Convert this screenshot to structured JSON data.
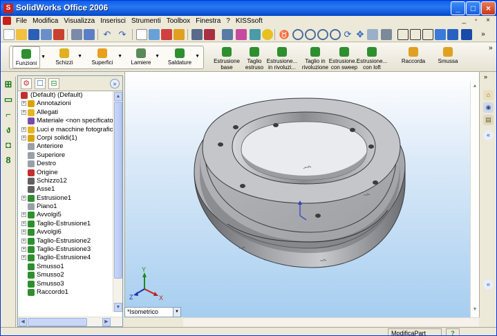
{
  "window": {
    "title": "SolidWorks Office 2006"
  },
  "menu": [
    "File",
    "Modifica",
    "Visualizza",
    "Inserisci",
    "Strumenti",
    "Toolbox",
    "Finestra",
    "?",
    "KISSsoft"
  ],
  "command_manager": {
    "left_group": [
      {
        "label": "Funzioni",
        "icon": "features-icon"
      },
      {
        "label": "Schizzi",
        "icon": "sketch-icon"
      },
      {
        "label": "Superfici",
        "icon": "surfaces-icon"
      },
      {
        "label": "Lamiere",
        "icon": "sheetmetal-icon"
      },
      {
        "label": "Saldature",
        "icon": "weldments-icon"
      }
    ],
    "right_group": [
      {
        "line1": "Estrusione",
        "line2": "base",
        "icon": "extrude-boss-icon"
      },
      {
        "line1": "Taglio",
        "line2": "estruso",
        "icon": "extrude-cut-icon"
      },
      {
        "line1": "Estrusione...",
        "line2": "in rivoluzi...",
        "icon": "revolve-boss-icon"
      },
      {
        "line1": "Taglio in",
        "line2": "rivoluzione",
        "icon": "revolve-cut-icon"
      },
      {
        "line1": "Estrusione...",
        "line2": "con sweep",
        "icon": "sweep-icon"
      },
      {
        "line1": "Estrusione...",
        "line2": "con loft",
        "icon": "loft-icon"
      },
      {
        "line1": "Raccorda",
        "line2": "",
        "icon": "fillet-icon"
      },
      {
        "line1": "Smussa",
        "line2": "",
        "icon": "chamfer-icon"
      }
    ]
  },
  "feature_tree": {
    "root": "(Default) (Default)",
    "items": [
      {
        "label": "Annotazioni",
        "expandable": true,
        "icon": "annotations-icon",
        "color": "#d8a300"
      },
      {
        "label": "Allegati",
        "expandable": true,
        "icon": "attachments-icon",
        "color": "#e8b420"
      },
      {
        "label": "Materiale <non specificato>",
        "expandable": false,
        "icon": "material-icon",
        "color": "#7a4aa8"
      },
      {
        "label": "Luci e macchine fotografiche",
        "expandable": true,
        "icon": "lights-icon",
        "color": "#e8b420"
      },
      {
        "label": "Corpi solidi(1)",
        "expandable": true,
        "icon": "solid-bodies-icon",
        "color": "#d8a300"
      },
      {
        "label": "Anteriore",
        "expandable": false,
        "icon": "plane-icon",
        "color": "#9aa0a8"
      },
      {
        "label": "Superiore",
        "expandable": false,
        "icon": "plane-icon",
        "color": "#9aa0a8"
      },
      {
        "label": "Destro",
        "expandable": false,
        "icon": "plane-icon",
        "color": "#9aa0a8"
      },
      {
        "label": "Origine",
        "expandable": false,
        "icon": "origin-icon",
        "color": "#c03030"
      },
      {
        "label": "Schizzo12",
        "expandable": false,
        "icon": "sketch-icon",
        "color": "#606060"
      },
      {
        "label": "Asse1",
        "expandable": false,
        "icon": "axis-icon",
        "color": "#606060"
      },
      {
        "label": "Estrusione1",
        "expandable": true,
        "icon": "extrude-icon",
        "color": "#2e8f2e"
      },
      {
        "label": "Piano1",
        "expandable": false,
        "icon": "plane-icon",
        "color": "#9aa0a8"
      },
      {
        "label": "Avvolgi5",
        "expandable": true,
        "icon": "wrap-icon",
        "color": "#2e8f2e"
      },
      {
        "label": "Taglio-Estrusione1",
        "expandable": true,
        "icon": "cut-extrude-icon",
        "color": "#2e8f2e"
      },
      {
        "label": "Avvolgi6",
        "expandable": true,
        "icon": "wrap-icon",
        "color": "#2e8f2e"
      },
      {
        "label": "Taglio-Estrusione2",
        "expandable": true,
        "icon": "cut-extrude-icon",
        "color": "#2e8f2e"
      },
      {
        "label": "Taglio-Estrusione3",
        "expandable": true,
        "icon": "cut-extrude-icon",
        "color": "#2e8f2e"
      },
      {
        "label": "Taglio-Estrusione4",
        "expandable": true,
        "icon": "cut-extrude-icon",
        "color": "#2e8f2e"
      },
      {
        "label": "Smusso1",
        "expandable": false,
        "icon": "chamfer-icon",
        "color": "#2e8f2e"
      },
      {
        "label": "Smusso2",
        "expandable": false,
        "icon": "chamfer-icon",
        "color": "#2e8f2e"
      },
      {
        "label": "Smusso3",
        "expandable": false,
        "icon": "chamfer-icon",
        "color": "#2e8f2e"
      },
      {
        "label": "Raccordo1",
        "expandable": false,
        "icon": "fillet-icon",
        "color": "#2e8f2e"
      }
    ]
  },
  "viewport": {
    "view_orientation": "*Isometrico",
    "triad": {
      "x": "X",
      "y": "Y",
      "z": "Z"
    }
  },
  "status_bar": {
    "mode": "ModificaPart",
    "help": "?"
  },
  "colors": {
    "titlebar": "#0a5fe8",
    "accent": "#2e8f2e",
    "viewport_bottom": "#a6cef0"
  }
}
